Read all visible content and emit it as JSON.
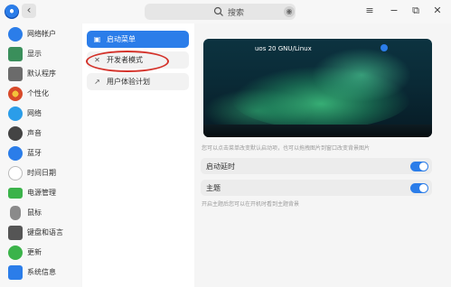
{
  "search": {
    "placeholder": "搜索"
  },
  "nav": {
    "items": [
      {
        "label": "网络帐户",
        "icon": "cloud-icon",
        "color": "#2b7de9"
      },
      {
        "label": "显示",
        "icon": "monitor-icon",
        "color": "#3a8f5b"
      },
      {
        "label": "默认程序",
        "icon": "default-apps-icon",
        "color": "#6b6b6b"
      },
      {
        "label": "个性化",
        "icon": "palette-icon",
        "color": "#d84a2a"
      },
      {
        "label": "网络",
        "icon": "network-icon",
        "color": "#2b9de9"
      },
      {
        "label": "声音",
        "icon": "speaker-icon",
        "color": "#444444"
      },
      {
        "label": "蓝牙",
        "icon": "bluetooth-icon",
        "color": "#2b7de9"
      },
      {
        "label": "时间日期",
        "icon": "clock-icon",
        "color": "#c9c9c9"
      },
      {
        "label": "电源管理",
        "icon": "battery-icon",
        "color": "#3bb34a"
      },
      {
        "label": "鼠标",
        "icon": "mouse-icon",
        "color": "#8a8a8a"
      },
      {
        "label": "键盘和语言",
        "icon": "keyboard-icon",
        "color": "#555555"
      },
      {
        "label": "更新",
        "icon": "update-icon",
        "color": "#3bb34a"
      },
      {
        "label": "系统信息",
        "icon": "system-info-icon",
        "color": "#2b7de9"
      }
    ]
  },
  "middle": {
    "items": [
      {
        "label": "启动菜单",
        "icon": "boot-menu-icon"
      },
      {
        "label": "开发者模式",
        "icon": "developer-icon"
      },
      {
        "label": "用户体验计划",
        "icon": "experience-icon"
      }
    ]
  },
  "right": {
    "preview_title": "uos 20 GNU/Linux",
    "hint_background": "您可以点击菜单改变默认启动项，也可以拖拽图片到窗口改变背景图片",
    "startup_delay_label": "启动延时",
    "theme_label": "主题",
    "theme_hint": "开启主题后您可以在开机时看到主题背景"
  },
  "colors": {
    "accent": "#2b7de9",
    "highlight": "#d4332b"
  }
}
